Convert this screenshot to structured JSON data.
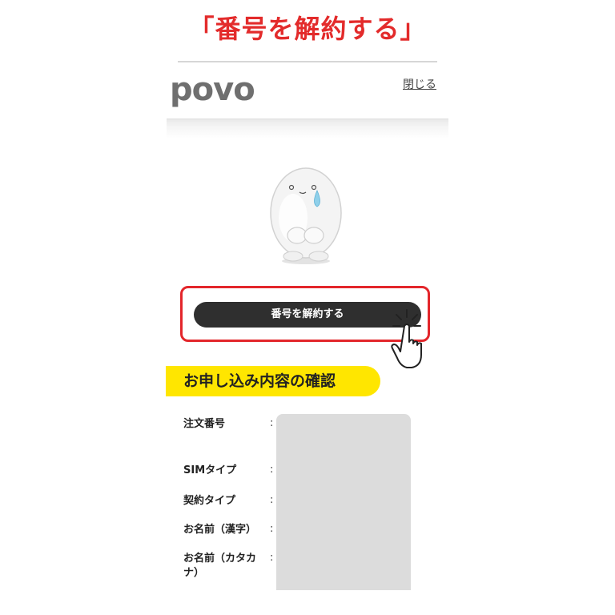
{
  "caption": "「番号を解約する」",
  "header": {
    "logo_text": "povo",
    "close_label": "閉じる"
  },
  "action": {
    "cancel_button_label": "番号を解約する"
  },
  "section": {
    "title": "お申し込み内容の確認"
  },
  "details": [
    {
      "label": "注文番号",
      "colon": ":"
    },
    {
      "label": "SIMタイプ",
      "colon": ":"
    },
    {
      "label": "契約タイプ",
      "colon": ":"
    },
    {
      "label": "お名前（漢字）",
      "colon": ":"
    },
    {
      "label": "お名前（カタカナ）",
      "colon": ":"
    }
  ],
  "colors": {
    "accent_red": "#e32b2b",
    "highlight_yellow": "#ffe600",
    "button_dark": "#2f2f2f"
  },
  "icons": [
    "mascot-image",
    "tap-hand-icon"
  ]
}
